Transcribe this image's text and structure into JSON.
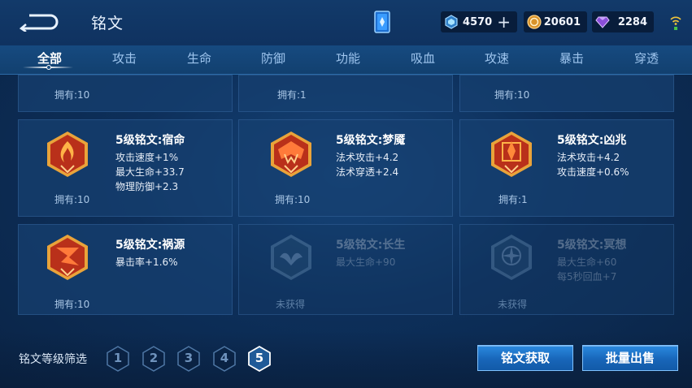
{
  "header": {
    "title": "铭文",
    "currencies": [
      {
        "icon": "gem-icon",
        "value": "4570"
      },
      {
        "icon": "coin-icon",
        "value": "20601"
      },
      {
        "icon": "diamond-icon",
        "value": "2284"
      }
    ]
  },
  "tabs": [
    {
      "label": "全部",
      "active": true
    },
    {
      "label": "攻击"
    },
    {
      "label": "生命"
    },
    {
      "label": "防御"
    },
    {
      "label": "功能"
    },
    {
      "label": "吸血"
    },
    {
      "label": "攻速"
    },
    {
      "label": "暴击"
    },
    {
      "label": "穿透"
    }
  ],
  "top_row": [
    {
      "owned": "拥有:10"
    },
    {
      "owned": "拥有:1"
    },
    {
      "owned": "拥有:10"
    }
  ],
  "cards": [
    {
      "name": "5级铭文:宿命",
      "attrs": [
        "攻击速度+1%",
        "最大生命+33.7",
        "物理防御+2.3"
      ],
      "owned": "拥有:10",
      "acquired": true,
      "icon": "flame-emblem-icon"
    },
    {
      "name": "5级铭文:梦魇",
      "attrs": [
        "法术攻击+4.2",
        "法术穿透+2.4"
      ],
      "owned": "拥有:10",
      "acquired": true,
      "icon": "nightmare-emblem-icon"
    },
    {
      "name": "5级铭文:凶兆",
      "attrs": [
        "法术攻击+4.2",
        "攻击速度+0.6%"
      ],
      "owned": "拥有:1",
      "acquired": true,
      "icon": "omen-emblem-icon"
    },
    {
      "name": "5级铭文:祸源",
      "attrs": [
        "暴击率+1.6%"
      ],
      "owned": "拥有:10",
      "acquired": true,
      "icon": "calamity-emblem-icon"
    },
    {
      "name": "5级铭文:长生",
      "attrs": [
        "最大生命+90"
      ],
      "owned": "未获得",
      "acquired": false,
      "icon": "longevity-emblem-icon"
    },
    {
      "name": "5级铭文:冥想",
      "attrs": [
        "最大生命+60",
        "每5秒回血+7"
      ],
      "owned": "未获得",
      "acquired": false,
      "icon": "meditation-emblem-icon"
    }
  ],
  "footer": {
    "filter_label": "铭文等级筛选",
    "levels": [
      "1",
      "2",
      "3",
      "4",
      "5"
    ],
    "active_level": "5",
    "acquire_button": "铭文获取",
    "sell_button": "批量出售"
  },
  "colors": {
    "accent_blue": "#1866b9",
    "emblem_red": "#c0361c",
    "emblem_gold": "#e9a33a"
  }
}
